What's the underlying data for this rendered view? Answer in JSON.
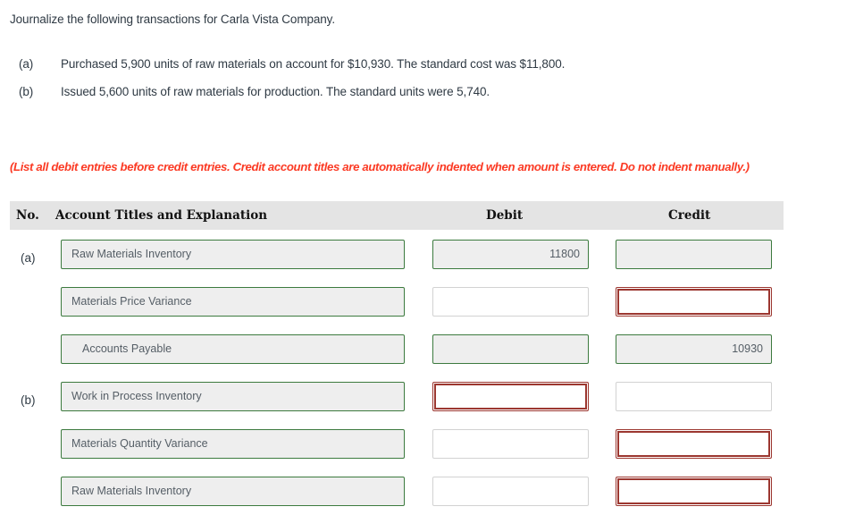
{
  "intro": "Journalize the following transactions for Carla Vista Company.",
  "transactions": [
    {
      "label": "(a)",
      "text": "Purchased 5,900 units of raw materials on account for $10,930. The standard cost was $11,800."
    },
    {
      "label": "(b)",
      "text": "Issued 5,600 units of raw materials for production. The standard units were 5,740."
    }
  ],
  "note": "(List all debit entries before credit entries. Credit account titles are automatically indented when amount is entered. Do not indent manually.)",
  "table": {
    "headers": {
      "no": "No.",
      "account": "Account Titles and Explanation",
      "debit": "Debit",
      "credit": "Credit"
    },
    "rows": [
      {
        "no": "(a)",
        "account": "Raw Materials Inventory",
        "account_state": "ok",
        "account_indent": false,
        "debit": "11800",
        "debit_state": "ok",
        "credit": "",
        "credit_state": "ok"
      },
      {
        "no": "",
        "account": "Materials Price Variance",
        "account_state": "ok",
        "account_indent": false,
        "debit": "",
        "debit_state": "empty",
        "credit": "",
        "credit_state": "err"
      },
      {
        "no": "",
        "account": "Accounts Payable",
        "account_state": "ok",
        "account_indent": true,
        "debit": "",
        "debit_state": "ok",
        "credit": "10930",
        "credit_state": "ok"
      },
      {
        "no": "(b)",
        "account": "Work in Process Inventory",
        "account_state": "ok",
        "account_indent": false,
        "debit": "",
        "debit_state": "err",
        "credit": "",
        "credit_state": "empty"
      },
      {
        "no": "",
        "account": "Materials Quantity Variance",
        "account_state": "ok",
        "account_indent": false,
        "debit": "",
        "debit_state": "empty",
        "credit": "",
        "credit_state": "err"
      },
      {
        "no": "",
        "account": "Raw Materials Inventory",
        "account_state": "ok",
        "account_indent": false,
        "debit": "",
        "debit_state": "empty",
        "credit": "",
        "credit_state": "err"
      }
    ]
  },
  "colors": {
    "note_red": "#fb3a24",
    "valid_green": "#3c7a3e",
    "error_red": "#9c3730",
    "header_band": "#e4e4e4",
    "field_fill": "#eeeeee"
  }
}
